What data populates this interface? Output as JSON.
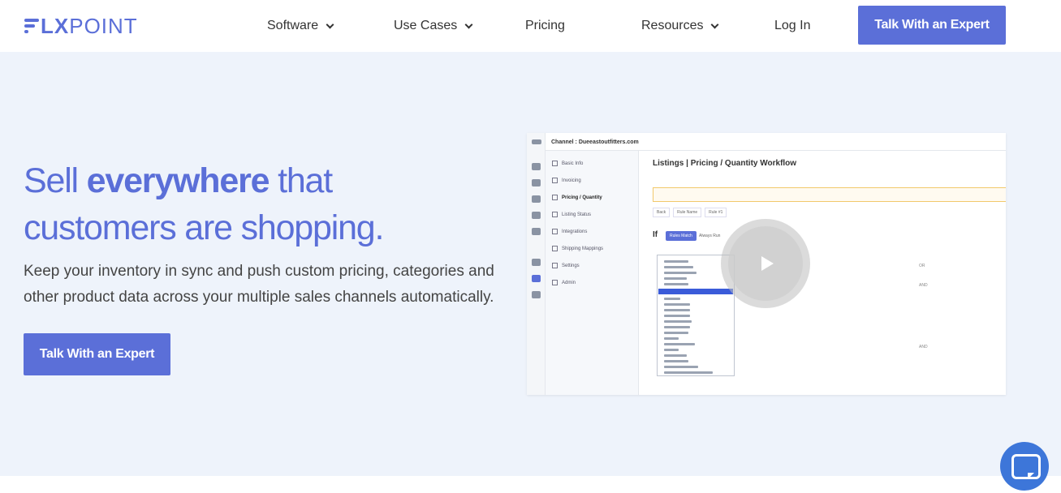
{
  "brand": {
    "logo_lx": "LX",
    "logo_point": "POINT",
    "accent": "#5b6fd8"
  },
  "nav": {
    "software": "Software",
    "use_cases": "Use Cases",
    "pricing": "Pricing",
    "resources": "Resources",
    "login": "Log In",
    "cta": "Talk With an Expert"
  },
  "hero": {
    "headline_pre": "Sell ",
    "headline_bold": "everywhere",
    "headline_post": " that customers are shopping.",
    "subcopy": "Keep your inventory in sync and push custom pricing, categories and other product data across your multiple sales channels automatically.",
    "cta": "Talk With an Expert"
  },
  "video_preview": {
    "channel": "Channel : Dueeastoutfitters.com",
    "title": "Listings | Pricing / Quantity Workflow",
    "sidebar": [
      "Basic Info",
      "Invoicing",
      "Pricing / Quantity",
      "Listing Status",
      "Integrations",
      "Shipping Mappings",
      "Settings",
      "Admin"
    ],
    "if_label": "If",
    "rules_match": "Rules Match",
    "always_run": "Always Run",
    "back": "Back",
    "rule_name": "Rule Name",
    "rule_value": "Rule #1",
    "or": "OR",
    "and": "AND"
  },
  "icons": {
    "play": "play-icon",
    "chat": "chat-bubble-icon",
    "chevron": "chevron-down-icon"
  }
}
